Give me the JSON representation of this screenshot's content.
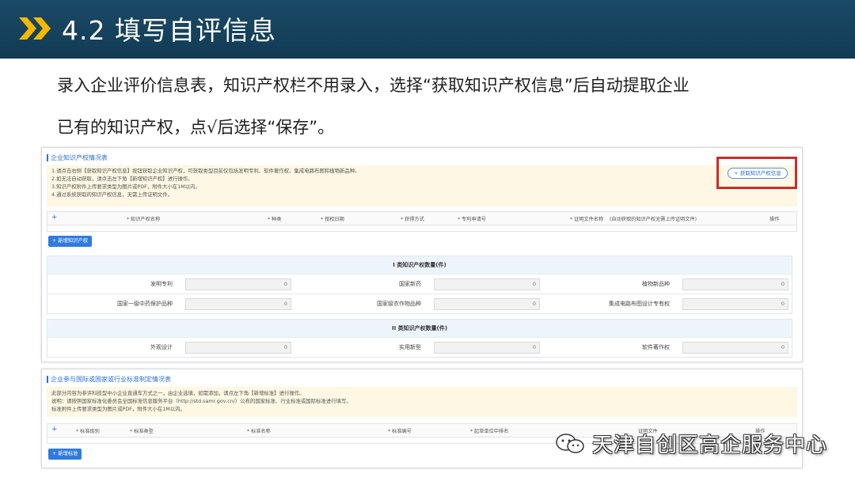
{
  "header": {
    "title": "4.2 填写自评信息"
  },
  "instruction": {
    "line1": "录入企业评价信息表，知识产权栏不用录入，选择“获取知识产权信息”后自动提取企业",
    "line2": "已有的知识产权，点√后选择“保存”。"
  },
  "ip_section": {
    "title": "企业知识产权情况表",
    "notes": [
      "1.请点击右侧【获取知识产权信息】按钮获取企业知识产权，可获取类型目前仅包括发明专利、软件著作权、集成电路布图和植物新品种。",
      "2.如无法自动获取，请点击左下角【新增知识产权】进行操作。",
      "3.知识产权附件上传要求类型为图片或PDF，附件大小在1M以内。",
      "4.通过系统获取的知识产权信息，无需上传证明文件。"
    ],
    "get_button": "+ 获取知识产权信息",
    "table_plus": "+",
    "columns": [
      "* 知识产权名称",
      "* 种类",
      "* 授权日期",
      "* 获得方式",
      "* 专利申请号",
      "* 证明文件名称",
      "操作"
    ],
    "red_note": "(自动获取的知识产权无需上传证明文件)",
    "add_button": "+ 新增知识产权",
    "class1_title": "I 类知识产权数量(件)",
    "class1": [
      [
        {
          "label": "发明专利",
          "value": "0"
        },
        {
          "label": "国家新药",
          "value": "0"
        },
        {
          "label": "植物新品种",
          "value": "0"
        }
      ],
      [
        {
          "label": "国家一级中药保护品种",
          "value": "0"
        },
        {
          "label": "国家级农作物品种",
          "value": "0"
        },
        {
          "label": "集成电路布图设计专有权",
          "value": "0"
        }
      ]
    ],
    "class2_title": "II 类知识产权数量(件)",
    "class2": [
      [
        {
          "label": "外观设计",
          "value": "0"
        },
        {
          "label": "实用新型",
          "value": "0"
        },
        {
          "label": "软件著作权",
          "value": "0"
        }
      ]
    ]
  },
  "std_section": {
    "title": "企业参与国际或国家或行业标准制定情况表",
    "notes": [
      "此部分内容为参评科技型中小企业直通车方式之一，由企业选填，如需添加，请点左下角【新增标准】进行操作。",
      "说明：请按照国家标准化委员会全国标准信息服务平台（http://std.samr.gov.cn/）公布的国家标准、行业标准或国际标准进行填写。",
      "标准附件上传要求类型为图片或PDF，附件大小在1M以内。"
    ],
    "table_plus": "+",
    "columns": [
      "* 标准级别",
      "* 标准类型",
      "* 标准名称",
      "* 标准编号",
      "* 起草单位中排名",
      "证明文件",
      "操作"
    ],
    "add_button": "+ 新增标准"
  },
  "watermark": "天津自创区高企服务中心",
  "colors": {
    "banner": "#123b55",
    "chevron": "#f5b800",
    "highlight": "#d02a2a",
    "link": "#2a6fd1"
  }
}
